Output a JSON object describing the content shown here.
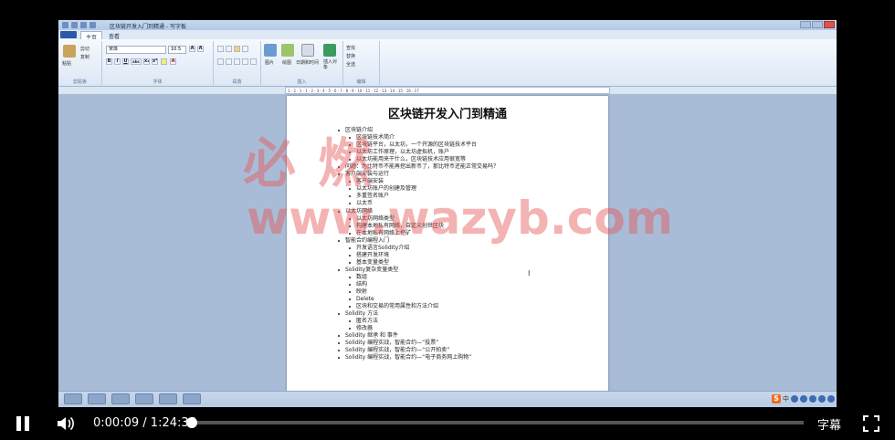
{
  "app": {
    "title": "区块链开发入门到精通 - 写字板",
    "tabs": [
      "主页",
      "查看"
    ]
  },
  "ribbon": {
    "clipboard": {
      "label": "剪贴板",
      "paste": "粘贴",
      "cut": "剪切",
      "copy": "复制"
    },
    "font": {
      "label": "字体",
      "font_name": "宋体",
      "font_size": "10.5",
      "bold": "B",
      "italic": "I",
      "underline": "U",
      "strike": "abc",
      "sub": "x₂",
      "sup": "x²"
    },
    "paragraph": {
      "label": "段落"
    },
    "insert": {
      "label": "插入",
      "picture": "图片",
      "paint": "绘图",
      "datetime": "日期和时间",
      "object": "插入对象"
    },
    "edit": {
      "label": "编辑",
      "find": "查找",
      "replace": "替换",
      "select_all": "全选"
    }
  },
  "ruler": {
    "marks": "1 · 2 · 1 · 1 · 2 · 3 · 4 · 5 · 6 · 7 · 8 · 9 · 10 · 11 · 12 · 13 · 14 · 15 · 16 · 17"
  },
  "document": {
    "title": "区块链开发入门到精通",
    "outline": [
      {
        "level": 1,
        "text": "区块链介绍"
      },
      {
        "level": 2,
        "text": "区块链技术简介"
      },
      {
        "level": 2,
        "text": "区块链平台，以太坊，一个开源的区块链技术平台"
      },
      {
        "level": 2,
        "text": "以太坊工作原理，以太坊虚拟机，账户"
      },
      {
        "level": 2,
        "text": "以太坊能用来干什么，区块链技术应用很宽等"
      },
      {
        "level": 1,
        "text": "问题：为比特币不能再挖出新币了，那比特币还能正常交易吗？"
      },
      {
        "level": 1,
        "text": "客户端安装与运行"
      },
      {
        "level": 2,
        "text": "客户端安装"
      },
      {
        "level": 2,
        "text": "以太坊账户的创建及管理"
      },
      {
        "level": 2,
        "text": "多重签名账户"
      },
      {
        "level": 2,
        "text": "以太币"
      },
      {
        "level": 1,
        "text": "以太坊网络"
      },
      {
        "level": 2,
        "text": "以太坊网络类型"
      },
      {
        "level": 2,
        "text": "构建本地私有网络，自定义创世区块"
      },
      {
        "level": 2,
        "text": "在本地私有网络上挖矿"
      },
      {
        "level": 1,
        "text": "智能合约编程入门"
      },
      {
        "level": 2,
        "text": "开发语言Solidity介绍"
      },
      {
        "level": 2,
        "text": "搭建开发环境"
      },
      {
        "level": 2,
        "text": "基本变量类型"
      },
      {
        "level": 1,
        "text": "Solidity复杂变量类型"
      },
      {
        "level": 2,
        "text": "数组"
      },
      {
        "level": 2,
        "text": "结构"
      },
      {
        "level": 2,
        "text": "映射"
      },
      {
        "level": 2,
        "text": "Delete"
      },
      {
        "level": 2,
        "text": "区块和交易的常用属性和方法介绍"
      },
      {
        "level": 1,
        "text": "Solidity 方法"
      },
      {
        "level": 2,
        "text": "匿名方法"
      },
      {
        "level": 2,
        "text": "修改器"
      },
      {
        "level": 1,
        "text": "Solidity 继承 和 事件"
      },
      {
        "level": 1,
        "text": "Solidity 编程实战，智能合约—“投票”"
      },
      {
        "level": 1,
        "text": "Solidity 编程实战，智能合约—“公开拍卖”"
      },
      {
        "level": 1,
        "text": "Solidity 编程实战，智能合约—“电子商务网上购物”"
      }
    ]
  },
  "watermark": {
    "line1": "必 燃",
    "line2": "www.wazyb.com"
  },
  "ime": {
    "logo": "S",
    "lang": "中"
  },
  "player": {
    "current_time": "0:00:09",
    "separator": "/",
    "duration": "1:24:36",
    "progress": 0.0018,
    "subtitles_label": "字幕"
  }
}
